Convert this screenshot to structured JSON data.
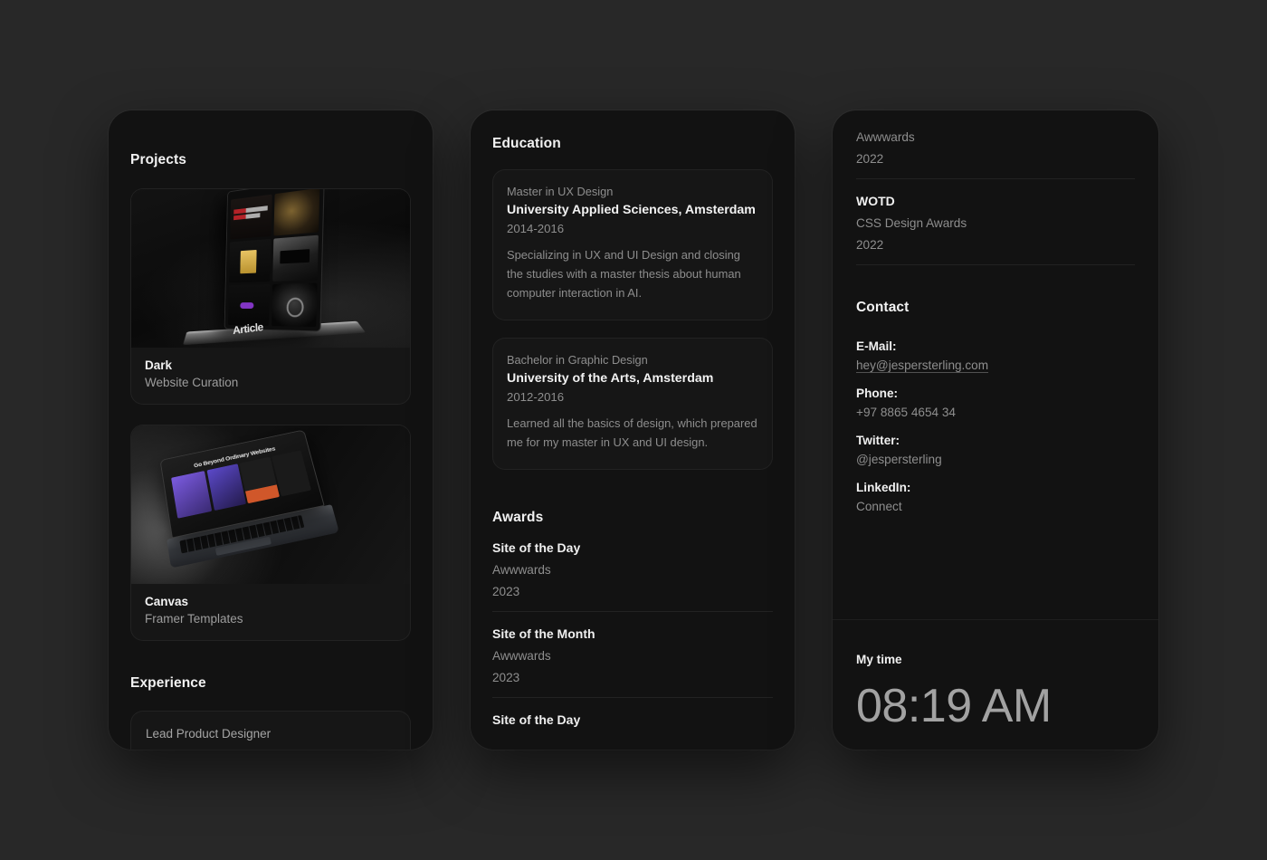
{
  "theme": {
    "page_background": "#282828",
    "panel_background": "#121212",
    "card_background": "#161616",
    "text_primary": "#f2f2f2",
    "text_muted": "#8e8e8e",
    "accent_purple": "#7b5be0",
    "accent_red": "#d0252c"
  },
  "projects_panel": {
    "title": "Projects",
    "items": [
      {
        "name": "Dark",
        "category": "Website Curation",
        "thumbnail": "tablet-dark-website-grid-mockup",
        "screen_word": "Article"
      },
      {
        "name": "Canvas",
        "category": "Framer Templates",
        "thumbnail": "macbook-framer-template-mockup",
        "screen_headline": "Go Beyond Ordinary Websites"
      }
    ],
    "experience": {
      "title": "Experience",
      "items": [
        {
          "role": "Lead Product Designer"
        }
      ]
    }
  },
  "education_panel": {
    "title": "Education",
    "items": [
      {
        "degree": "Master in UX Design",
        "school": "University Applied Sciences, Amsterdam",
        "years": "2014-2016",
        "description": "Specializing in UX and UI Design and closing the studies with a master thesis about human computer interaction in AI."
      },
      {
        "degree": "Bachelor in Graphic Design",
        "school": "University of the Arts, Amsterdam",
        "years": "2012-2016",
        "description": "Learned all the basics of design, which prepared me for my master in UX and UI design."
      }
    ],
    "awards": {
      "title": "Awards",
      "items": [
        {
          "name": "Site of the Day",
          "org": "Awwwards",
          "year": "2023"
        },
        {
          "name": "Site of the Month",
          "org": "Awwwards",
          "year": "2023"
        },
        {
          "name": "Site of the Day",
          "org": "",
          "year": ""
        }
      ]
    }
  },
  "contact_panel": {
    "awards_continued": [
      {
        "name": "",
        "org": "Awwwards",
        "year": "2022"
      },
      {
        "name": "WOTD",
        "org": "CSS Design Awards",
        "year": "2022"
      }
    ],
    "contact": {
      "title": "Contact",
      "rows": [
        {
          "label": "E-Mail:",
          "value": "hey@jespersterling.com",
          "is_link": true
        },
        {
          "label": "Phone:",
          "value": "+97 8865 4654 34",
          "is_link": false
        },
        {
          "label": "Twitter:",
          "value": "@jespersterling",
          "is_link": false
        },
        {
          "label": "LinkedIn:",
          "value": "Connect",
          "is_link": false
        }
      ]
    },
    "my_time": {
      "label": "My time",
      "value": "08:19 AM"
    }
  }
}
